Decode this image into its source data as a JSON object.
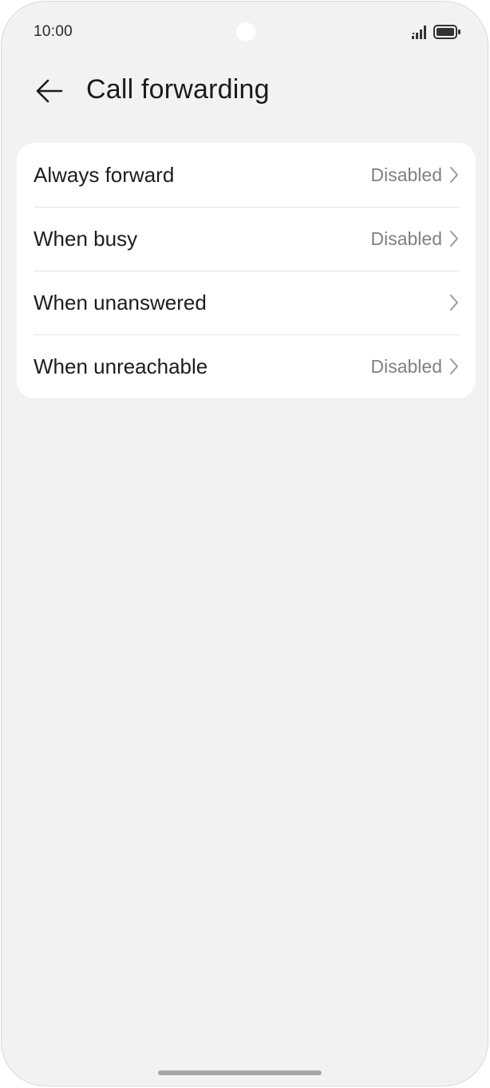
{
  "status_bar": {
    "time": "10:00",
    "signal_icon": "signal-bars-icon",
    "battery_icon": "battery-icon"
  },
  "header": {
    "back_icon": "arrow-left-icon",
    "title": "Call forwarding"
  },
  "forwarding_options": [
    {
      "label": "Always forward",
      "value": "Disabled"
    },
    {
      "label": "When busy",
      "value": "Disabled"
    },
    {
      "label": "When unanswered",
      "value": ""
    },
    {
      "label": "When unreachable",
      "value": "Disabled"
    }
  ],
  "colors": {
    "background": "#f1f2f4",
    "card": "#ffffff",
    "primary_text": "#1d1d1d",
    "secondary_text": "#808080"
  }
}
